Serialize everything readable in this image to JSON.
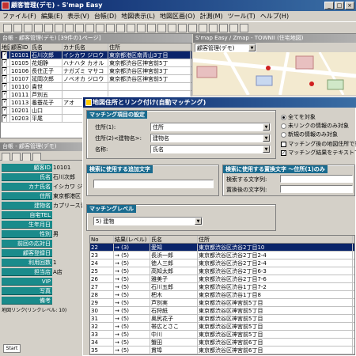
{
  "app": {
    "title": "顧客管理(デモ) - S'map Easy"
  },
  "menu": [
    "ファイル(F)",
    "編集(E)",
    "表示(V)",
    "台帳(D)",
    "地図表示(L)",
    "地図区画(O)",
    "計測(M)",
    "ツール(T)",
    "ヘルプ(H)"
  ],
  "list_panel": {
    "title": "台帳 - 顧客管理(デモ) [39件の1ページ]",
    "columns": [
      "地図",
      "顧客ID",
      "氏名",
      "カナ氏名",
      "住所"
    ],
    "rows": [
      {
        "id": "10101",
        "name": "石川次郎",
        "kana": "イシカワ ジロウ",
        "addr": "東京都港区南青山3丁目"
      },
      {
        "id": "10105",
        "name": "花畑静",
        "kana": "ハナハタ カオル",
        "addr": "東京都渋谷区神宮前5丁"
      },
      {
        "id": "10106",
        "name": "長住正子",
        "kana": "ナガズミ マサコ",
        "addr": "東京都渋谷区神宮前3丁"
      },
      {
        "id": "10107",
        "name": "延岡次郎",
        "kana": "ノベオカ ジロウ",
        "addr": "東京都渋谷区神宮前5丁"
      },
      {
        "id": "10110",
        "name": "貴世",
        "kana": "",
        "addr": ""
      },
      {
        "id": "10111",
        "name": "芦別五",
        "kana": "",
        "addr": ""
      },
      {
        "id": "10113",
        "name": "養蚕花子",
        "kana": "アオ",
        "addr": ""
      },
      {
        "id": "10201",
        "name": "山口",
        "kana": "",
        "addr": ""
      },
      {
        "id": "10203",
        "name": "平尾",
        "kana": "",
        "addr": ""
      }
    ]
  },
  "detail_panel": {
    "title": "台帳 - 顧客管理(デモ)",
    "fields": [
      {
        "label": "顧客ID",
        "value": "10101"
      },
      {
        "label": "氏名",
        "value": "石川次郎"
      },
      {
        "label": "カナ氏名",
        "value": "イシカワ ジロウ"
      },
      {
        "label": "住所",
        "value": "東京都港区"
      },
      {
        "label": "建物名",
        "value": "カプリース青山"
      },
      {
        "label": "自宅TEL",
        "value": ""
      },
      {
        "label": "生年月日",
        "value": ""
      },
      {
        "label": "性別",
        "value": "男"
      },
      {
        "label": "前回の応対日",
        "value": ""
      },
      {
        "label": "顧客登録日",
        "value": ""
      },
      {
        "label": "利用回数",
        "value": "1"
      },
      {
        "label": "担当店",
        "value": "A店"
      },
      {
        "label": "VIP",
        "value": ""
      },
      {
        "label": "写真",
        "value": ""
      },
      {
        "label": "備考",
        "value": ""
      }
    ],
    "footer": "地図リンク(リンクレベル: 10)",
    "tab": "Start"
  },
  "map_panel": {
    "title": "S'map Easy / Zmap - TOWNII (住宅地図)",
    "layer": "顧客管理(デモ)"
  },
  "dialog": {
    "title": "地図住所とリンク付け(自動マッチング)",
    "group_match": "マッチング項目の設定",
    "addr_label": "住所(1):",
    "addr_value": "住所",
    "bld_label": "住所(2)<建物名>:",
    "bld_value": "建物名",
    "name_label": "名称:",
    "name_value": "氏名",
    "radios": [
      "全てを対象",
      "未リンクの情報のみ対象",
      "新規の情報のみ対象"
    ],
    "checks": [
      "マッチング後の地図住所で更新する",
      "マッチング結果をテキストで出力"
    ],
    "group_search": "検索に使用する追加文字",
    "group_replace": "検索に使用する置換文字 〜住所(1)のみ",
    "search_str_label": "検索する文字列:",
    "replace_str_label": "置換後の文字列:",
    "group_level": "マッチングレベル",
    "level_value": "5) 建物",
    "result_cols": [
      "No",
      "結果(レベル)",
      "氏名",
      "住所"
    ],
    "results": [
      {
        "no": "22",
        "lvl": "→ (3)",
        "name": "愛知",
        "addr": "東京都渋谷区渋谷2丁目10"
      },
      {
        "no": "23",
        "lvl": "→ (5)",
        "name": "長浜一郎",
        "addr": "東京都渋谷区渋谷2丁目2-4"
      },
      {
        "no": "24",
        "lvl": "→ (5)",
        "name": "徳人三郎",
        "addr": "東京都渋谷区渋谷2丁目2-4"
      },
      {
        "no": "25",
        "lvl": "→ (5)",
        "name": "高知太郎",
        "addr": "東京都渋谷区渋谷2丁目6-3"
      },
      {
        "no": "26",
        "lvl": "→ (5)",
        "name": "雅美子",
        "addr": "東京都渋谷区渋谷2丁目7-6"
      },
      {
        "no": "27",
        "lvl": "→ (5)",
        "name": "石川五郎",
        "addr": "東京都渋谷区渋谷1丁目7-2"
      },
      {
        "no": "28",
        "lvl": "→ (5)",
        "name": "杷木",
        "addr": "東京都渋谷区渋谷1丁目8"
      },
      {
        "no": "29",
        "lvl": "→ (5)",
        "name": "芦別実",
        "addr": "東京都渋谷区神宮前5丁目"
      },
      {
        "no": "30",
        "lvl": "→ (5)",
        "name": "石狩紙",
        "addr": "東京都渋谷区神宮前5丁目"
      },
      {
        "no": "31",
        "lvl": "→ (5)",
        "name": "奥尻花子",
        "addr": "東京都渋谷区神宮前5丁目"
      },
      {
        "no": "32",
        "lvl": "→ (5)",
        "name": "帯広とさこ",
        "addr": "東京都渋谷区神宮前5丁目"
      },
      {
        "no": "33",
        "lvl": "→ (5)",
        "name": "中川",
        "addr": "東京都渋谷区神宮前5丁目"
      },
      {
        "no": "34",
        "lvl": "→ (5)",
        "name": "蟹田",
        "addr": "東京都渋谷区神宮前6丁目"
      },
      {
        "no": "35",
        "lvl": "→ (5)",
        "name": "貫埠",
        "addr": "東京都渋谷区神宮前6丁目"
      }
    ]
  },
  "colors": {
    "title": "#0a246a",
    "label_bg": "#1a8b8b",
    "group_title": "#1a6b8f"
  }
}
